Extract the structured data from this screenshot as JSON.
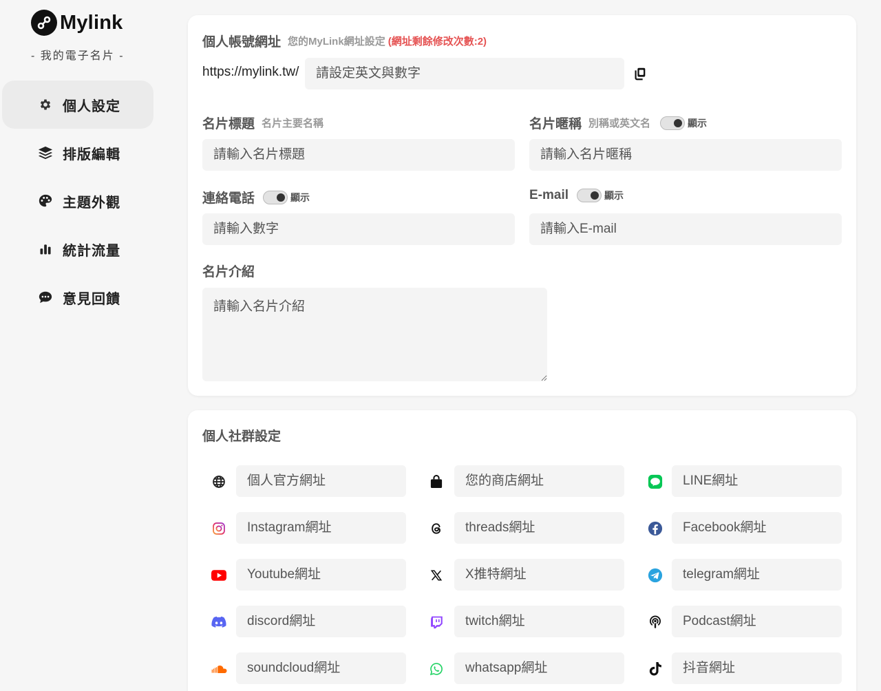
{
  "brand": {
    "name": "Mylink",
    "subtitle": "- 我的電子名片 -"
  },
  "sidebar": {
    "items": [
      {
        "label": "個人設定",
        "icon": "gear-icon",
        "active": true
      },
      {
        "label": "排版編輯",
        "icon": "layers-icon",
        "active": false
      },
      {
        "label": "主題外觀",
        "icon": "palette-icon",
        "active": false
      },
      {
        "label": "統計流量",
        "icon": "bar-chart-icon",
        "active": false
      },
      {
        "label": "意見回饋",
        "icon": "comment-icon",
        "active": false
      }
    ]
  },
  "account": {
    "title": "個人帳號網址",
    "hint": "您的MyLink網址設定",
    "warning": "(網址剩餘修改次數:2)",
    "prefix": "https://mylink.tw/",
    "placeholder": "請設定英文與數字"
  },
  "card_title": {
    "label": "名片標題",
    "hint": "名片主要名稱",
    "placeholder": "請輸入名片標題"
  },
  "nickname": {
    "label": "名片暱稱",
    "hint": "別稱或英文名",
    "toggle_label": "顯示",
    "placeholder": "請輸入名片暱稱"
  },
  "phone": {
    "label": "連絡電話",
    "toggle_label": "顯示",
    "placeholder": "請輸入數字"
  },
  "email": {
    "label": "E-mail",
    "toggle_label": "顯示",
    "placeholder": "請輸入E-mail"
  },
  "intro": {
    "label": "名片介紹",
    "placeholder": "請輸入名片介紹"
  },
  "social": {
    "title": "個人社群設定",
    "fields": [
      {
        "placeholder": "個人官方網址",
        "icon": "globe-icon"
      },
      {
        "placeholder": "您的商店網址",
        "icon": "shopping-bag-icon"
      },
      {
        "placeholder": "LINE網址",
        "icon": "line-icon",
        "color": "#06c755"
      },
      {
        "placeholder": "Instagram網址",
        "icon": "instagram-icon",
        "color": "#e1306c"
      },
      {
        "placeholder": "threads網址",
        "icon": "threads-icon"
      },
      {
        "placeholder": "Facebook網址",
        "icon": "facebook-icon",
        "color": "#3b5998"
      },
      {
        "placeholder": "Youtube網址",
        "icon": "youtube-icon",
        "color": "#ff0000"
      },
      {
        "placeholder": "X推特網址",
        "icon": "x-icon"
      },
      {
        "placeholder": "telegram網址",
        "icon": "telegram-icon",
        "color": "#2aa3df"
      },
      {
        "placeholder": "discord網址",
        "icon": "discord-icon",
        "color": "#5865f2"
      },
      {
        "placeholder": "twitch網址",
        "icon": "twitch-icon",
        "color": "#9146ff"
      },
      {
        "placeholder": "Podcast網址",
        "icon": "podcast-icon"
      },
      {
        "placeholder": "soundcloud網址",
        "icon": "soundcloud-icon",
        "color": "#ff6a00"
      },
      {
        "placeholder": "whatsapp網址",
        "icon": "whatsapp-icon",
        "color": "#25d366"
      },
      {
        "placeholder": "抖音網址",
        "icon": "tiktok-icon"
      }
    ]
  }
}
